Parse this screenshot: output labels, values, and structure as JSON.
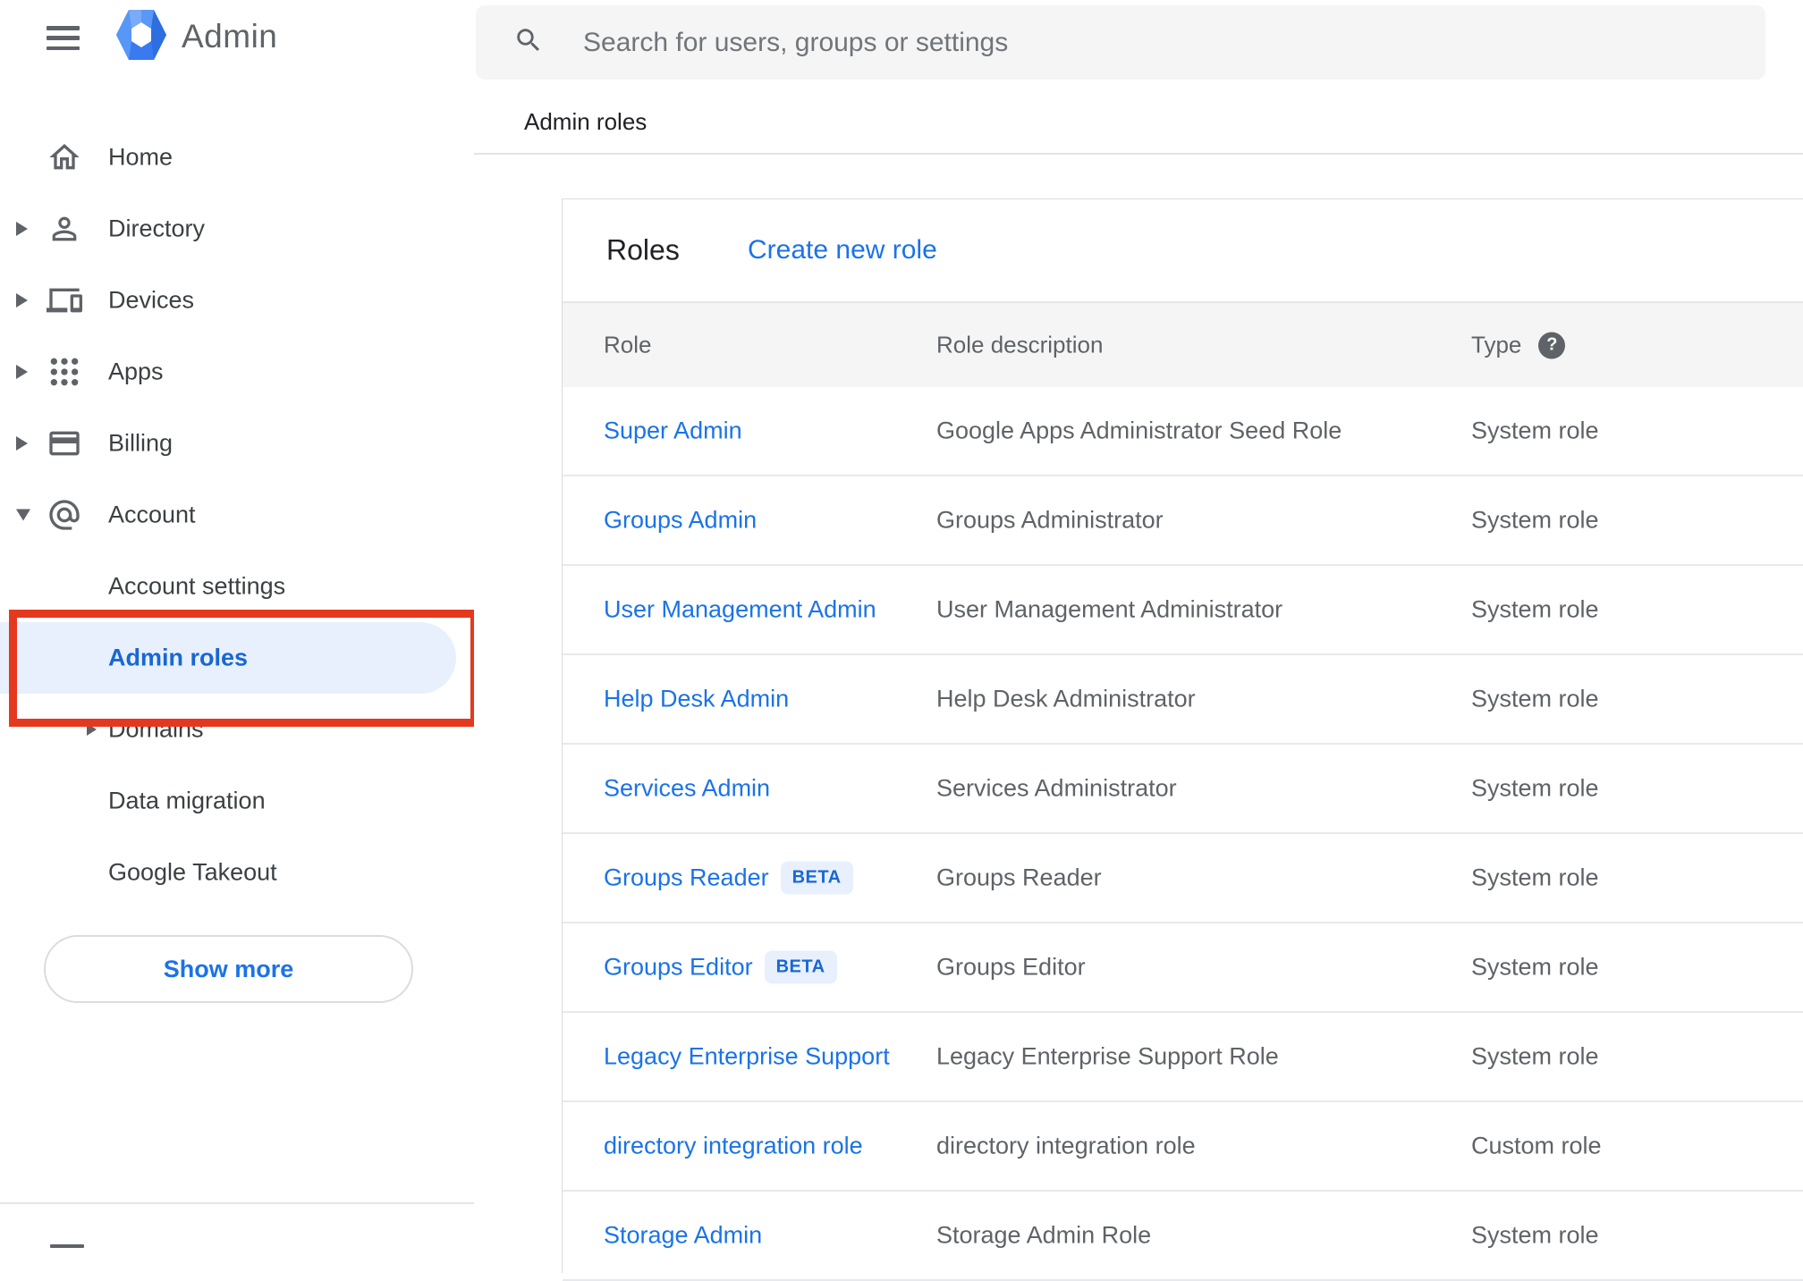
{
  "header": {
    "logo_text": "Admin",
    "search_placeholder": "Search for users, groups or settings"
  },
  "breadcrumb": "Admin roles",
  "sidebar": {
    "items": [
      {
        "label": "Home",
        "icon": "home",
        "expander": ""
      },
      {
        "label": "Directory",
        "icon": "person",
        "expander": "right"
      },
      {
        "label": "Devices",
        "icon": "devices",
        "expander": "right"
      },
      {
        "label": "Apps",
        "icon": "apps",
        "expander": "right"
      },
      {
        "label": "Billing",
        "icon": "billing",
        "expander": "right"
      },
      {
        "label": "Account",
        "icon": "account",
        "expander": "down"
      }
    ],
    "subitems": [
      {
        "label": "Account settings",
        "expander": "",
        "selected": false
      },
      {
        "label": "Admin roles",
        "expander": "",
        "selected": true,
        "annotated": true
      },
      {
        "label": "Domains",
        "expander": "right",
        "selected": false
      },
      {
        "label": "Data migration",
        "expander": "",
        "selected": false
      },
      {
        "label": "Google Takeout",
        "expander": "",
        "selected": false
      }
    ],
    "show_more_label": "Show more"
  },
  "main": {
    "card_title": "Roles",
    "create_link": "Create new role",
    "beta_label": "BETA",
    "table": {
      "columns": [
        "Role",
        "Role description",
        "Type"
      ],
      "rows": [
        {
          "role": "Super Admin",
          "beta": false,
          "description": "Google Apps Administrator Seed Role",
          "type": "System role"
        },
        {
          "role": "Groups Admin",
          "beta": false,
          "description": "Groups Administrator",
          "type": "System role"
        },
        {
          "role": "User Management Admin",
          "beta": false,
          "description": "User Management Administrator",
          "type": "System role"
        },
        {
          "role": "Help Desk Admin",
          "beta": false,
          "description": "Help Desk Administrator",
          "type": "System role"
        },
        {
          "role": "Services Admin",
          "beta": false,
          "description": "Services Administrator",
          "type": "System role"
        },
        {
          "role": "Groups Reader",
          "beta": true,
          "description": "Groups Reader",
          "type": "System role"
        },
        {
          "role": "Groups Editor",
          "beta": true,
          "description": "Groups Editor",
          "type": "System role"
        },
        {
          "role": "Legacy Enterprise Support",
          "beta": false,
          "description": "Legacy Enterprise Support Role",
          "type": "System role"
        },
        {
          "role": "directory integration role",
          "beta": false,
          "description": "directory integration role",
          "type": "Custom role"
        },
        {
          "role": "Storage Admin",
          "beta": false,
          "description": "Storage Admin Role",
          "type": "System role"
        }
      ]
    }
  },
  "colors": {
    "link_blue": "#1a73e8",
    "selected_blue": "#1967d2",
    "selected_bg": "#e8f0fe",
    "annotation_red": "#e5391f",
    "table_header_bg": "#f5f5f6",
    "icon_gray": "#5f6368",
    "text_dark": "#202124"
  }
}
